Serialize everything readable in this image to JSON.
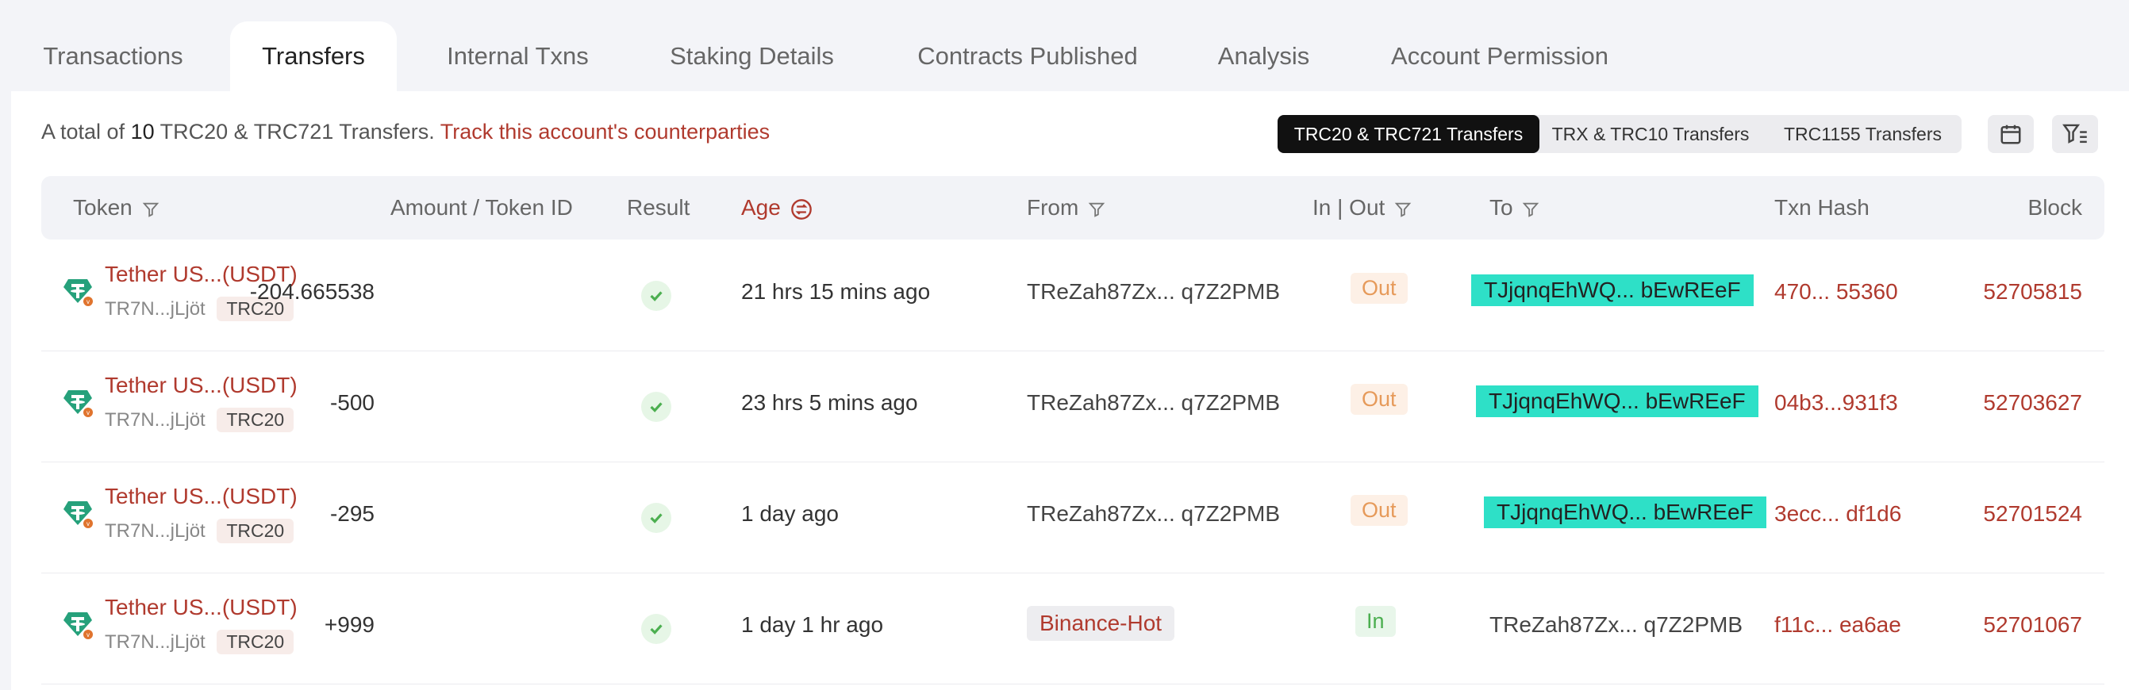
{
  "tabs": [
    {
      "label": "Transactions"
    },
    {
      "label": "Transfers"
    },
    {
      "label": "Internal Txns"
    },
    {
      "label": "Staking Details"
    },
    {
      "label": "Contracts Published"
    },
    {
      "label": "Analysis"
    },
    {
      "label": "Account Permission"
    }
  ],
  "summary": {
    "prefix": "A total of",
    "count": "10",
    "suffix": "TRC20 & TRC721 Transfers.",
    "link": "Track this account's counterparties"
  },
  "filters": {
    "options": [
      "TRC20 & TRC721 Transfers",
      "TRX & TRC10 Transfers",
      "TRC1155 Transfers"
    ],
    "selected": "TRC20 & TRC721 Transfers"
  },
  "columns": {
    "token": "Token",
    "amount": "Amount / Token ID",
    "result": "Result",
    "age": "Age",
    "from": "From",
    "inout": "In | Out",
    "to": "To",
    "hash": "Txn Hash",
    "block": "Block"
  },
  "rows": [
    {
      "token_name": "Tether US...(USDT)",
      "token_addr": "TR7N...jLjöt",
      "token_std": "TRC20",
      "amount": "-204.665538",
      "age": "21 hrs 15 mins ago",
      "from": "TReZah87Zx... q7Z2PMB",
      "direction": "Out",
      "to": "TJjqnqEhWQ... bEwREeF",
      "hash": "470... 55360",
      "block": "52705815"
    },
    {
      "token_name": "Tether US...(USDT)",
      "token_addr": "TR7N...jLjöt",
      "token_std": "TRC20",
      "amount": "-500",
      "age": "23 hrs 5 mins ago",
      "from": "TReZah87Zx... q7Z2PMB",
      "direction": "Out",
      "to": "TJjqnqEhWQ... bEwREeF",
      "hash": "04b3...931f3",
      "block": "52703627"
    },
    {
      "token_name": "Tether US...(USDT)",
      "token_addr": "TR7N...jLjöt",
      "token_std": "TRC20",
      "amount": "-295",
      "age": "1 day ago",
      "from": "TReZah87Zx... q7Z2PMB",
      "direction": "Out",
      "to": "TJjqnqEhWQ... bEwREeF",
      "hash": "3ecc... df1d6",
      "block": "52701524"
    },
    {
      "token_name": "Tether US...(USDT)",
      "token_addr": "TR7N...jLjöt",
      "token_std": "TRC20",
      "amount": "+999",
      "age": "1 day 1 hr ago",
      "from": "Binance-Hot",
      "direction": "In",
      "to": "TReZah87Zx... q7Z2PMB",
      "hash": "f11c... ea6ae",
      "block": "52701067"
    }
  ],
  "colors": {
    "accent": "#b03a2e",
    "highlight": "#2ee0c7",
    "tether": "#26a17b",
    "success": "#4caf50"
  }
}
